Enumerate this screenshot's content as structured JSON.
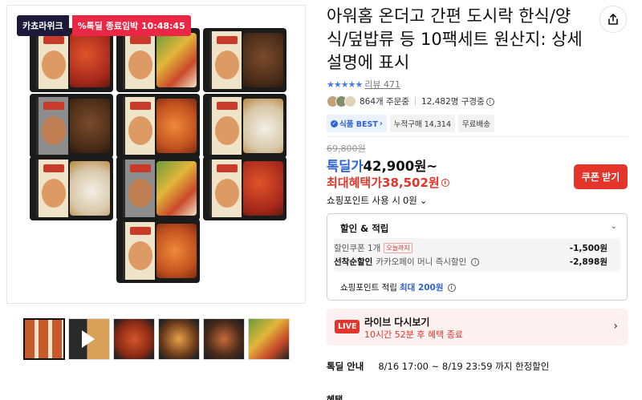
{
  "gallery": {
    "badge_brand": "카쵸라위크",
    "badge_deal_label": "%톡딜 종료임박 10:48:45",
    "thumbnails": [
      "thumb-1",
      "thumb-video",
      "thumb-3",
      "thumb-4",
      "thumb-5",
      "thumb-6"
    ]
  },
  "product": {
    "title": "아워홈 온더고 간편 도시락 한식/양식/덮밥류 등 10팩세트 원산지: 상세설명에 표시",
    "rating_stars": "★★★★★",
    "review_label": "리뷰 471",
    "orders": "864개 주문중",
    "subscribers": "12,482명 구경중",
    "tags": [
      "식품 BEST",
      "누적구매 14,314",
      "무료배송"
    ]
  },
  "price": {
    "original": "69,800원",
    "deal_label": "톡딜가",
    "deal_value": "42,900원~",
    "max_label": "최대혜택가",
    "max_value": "38,502원",
    "coupon_button": "쿠폰 받기",
    "points_label": "쇼핑포인트 사용 시",
    "points_value": "0원"
  },
  "benefits": {
    "title": "할인 & 적립",
    "coupon_label": "할인쿠폰 1개",
    "coupon_tag": "오늘까지",
    "coupon_amount": "-1,500원",
    "firstcome_label": "선착순할인",
    "firstcome_desc": "카카오페이 머니 즉시할인",
    "firstcome_amount": "-2,898원",
    "points_label": "쇼핑포인트 적립",
    "points_max": "최대 200원"
  },
  "live": {
    "badge": "LIVE",
    "title": "라이브 다시보기",
    "subtitle": "10시간 52분 후 혜택 종료"
  },
  "notice": {
    "label": "톡딜 안내",
    "period": "8/16 17:00 ~ 8/19 23:59 까지 한정할인"
  },
  "benefit_row_label": "혜택",
  "colors": {
    "accent_red": "#e4352a",
    "accent_blue": "#2d63d6",
    "badge_navy": "#1b1a3b"
  }
}
